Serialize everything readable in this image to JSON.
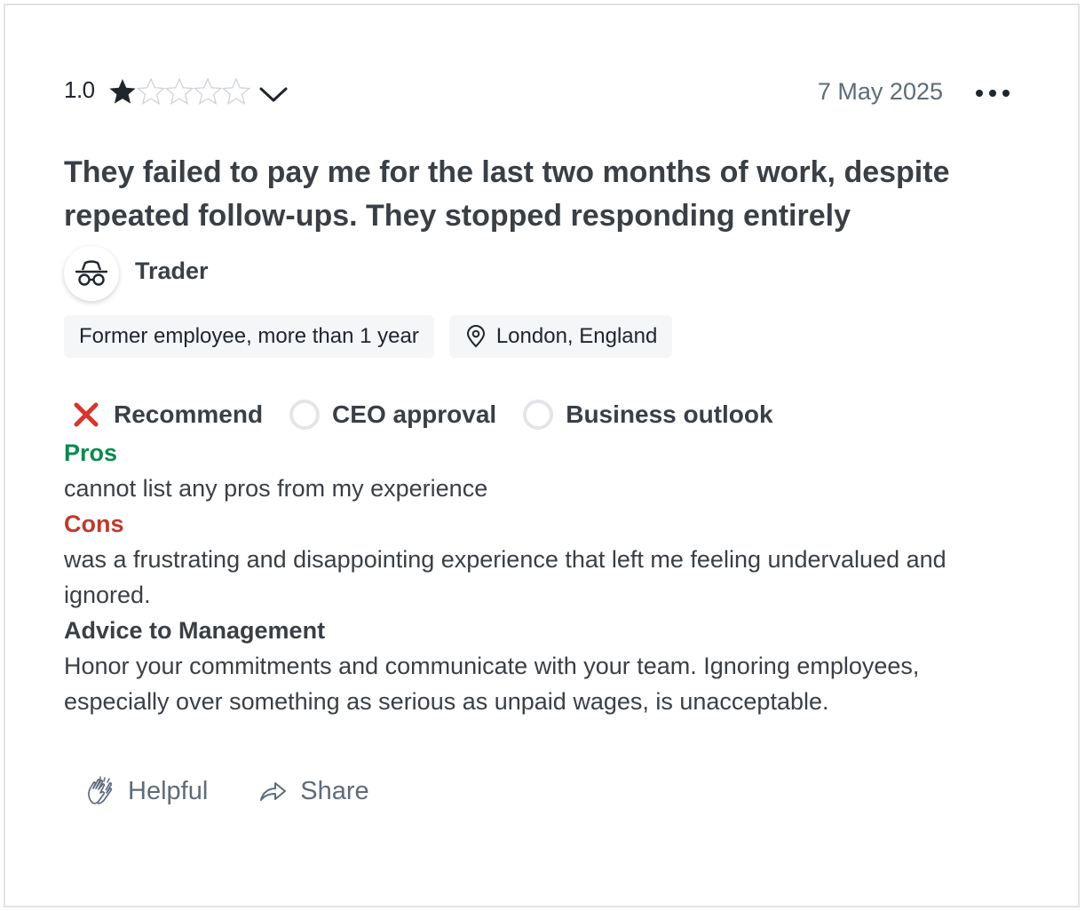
{
  "review": {
    "rating_value": "1.0",
    "rating_stars_filled": 1,
    "rating_stars_total": 5,
    "date": "7 May 2025",
    "title": "They failed to pay me for the last two months of work, despite repeated follow-ups. They stopped responding entirely",
    "job_title": "Trader",
    "employment_status": "Former employee, more than 1 year",
    "location": "London, England",
    "indicators": {
      "recommend": "Recommend",
      "ceo_approval": "CEO approval",
      "business_outlook": "Business outlook"
    },
    "pros_label": "Pros",
    "pros_text": "cannot list any pros from my experience",
    "cons_label": "Cons",
    "cons_text": "was a frustrating and disappointing experience that left me feeling undervalued and ignored.",
    "advice_label": "Advice to Management",
    "advice_text": "Honor your commitments and communicate with your team. Ignoring employees, especially over something as serious as unpaid wages, is unacceptable.",
    "actions": {
      "helpful": "Helpful",
      "share": "Share"
    }
  },
  "icons": {
    "star": "star-icon",
    "chevron": "chevron-down-icon",
    "more": "more-horizontal-icon",
    "avatar": "incognito-avatar-icon",
    "location": "map-pin-icon",
    "recommend_status": "x-mark-icon",
    "neutral_status": "empty-circle-icon",
    "helpful": "clapping-hands-icon",
    "share": "share-arrow-icon"
  },
  "colors": {
    "pros": "#0a8a4f",
    "cons": "#c0392b",
    "x_mark": "#d9352c",
    "muted": "#5f6b7a"
  }
}
